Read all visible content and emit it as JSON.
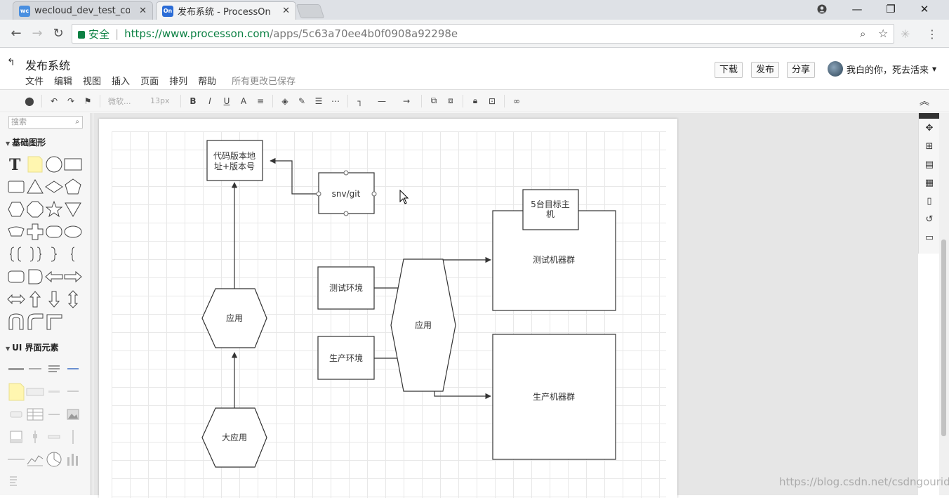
{
  "browser": {
    "tabs": [
      {
        "title": "wecloud_dev_test_conf",
        "favicon_color": "#4a8fe0",
        "favicon_text": "wc",
        "active": false
      },
      {
        "title": "发布系统 - ProcessOn",
        "favicon_color": "#2b6cd6",
        "favicon_text": "On",
        "active": true
      }
    ],
    "security_label": "安全",
    "url_host": "https://www.processon.com",
    "url_path": "/apps/5c63a70ee4b0f0908a92298e"
  },
  "app": {
    "doc_title": "发布系统",
    "menu": [
      "文件",
      "编辑",
      "视图",
      "插入",
      "页面",
      "排列",
      "帮助"
    ],
    "save_status": "所有更改已保存",
    "buttons": {
      "download": "下载",
      "publish": "发布",
      "share": "分享"
    },
    "user_name": "我白的你，死去活来"
  },
  "toolbar": {
    "font_family": "微软...",
    "font_size": "13px"
  },
  "left_panel": {
    "search_placeholder": "搜索",
    "categories": {
      "basic": "基础图形",
      "ui": "UI 界面元素"
    }
  },
  "diagram": {
    "nodes": {
      "repo": "代码版本地址+版本号",
      "repo_line1": "代码版本地",
      "repo_line2": "址+版本号",
      "svn": "snv/git",
      "app_top": "应用",
      "big_app": "大应用",
      "test_env": "测试环境",
      "prod_env": "生产环境",
      "app_mid": "应用",
      "target_line1": "5台目标主",
      "target_line2": "机",
      "test_cluster": "测试机器群",
      "prod_cluster": "生产机器群"
    }
  },
  "watermark": "https://blog.csdn.net/csdngouride"
}
